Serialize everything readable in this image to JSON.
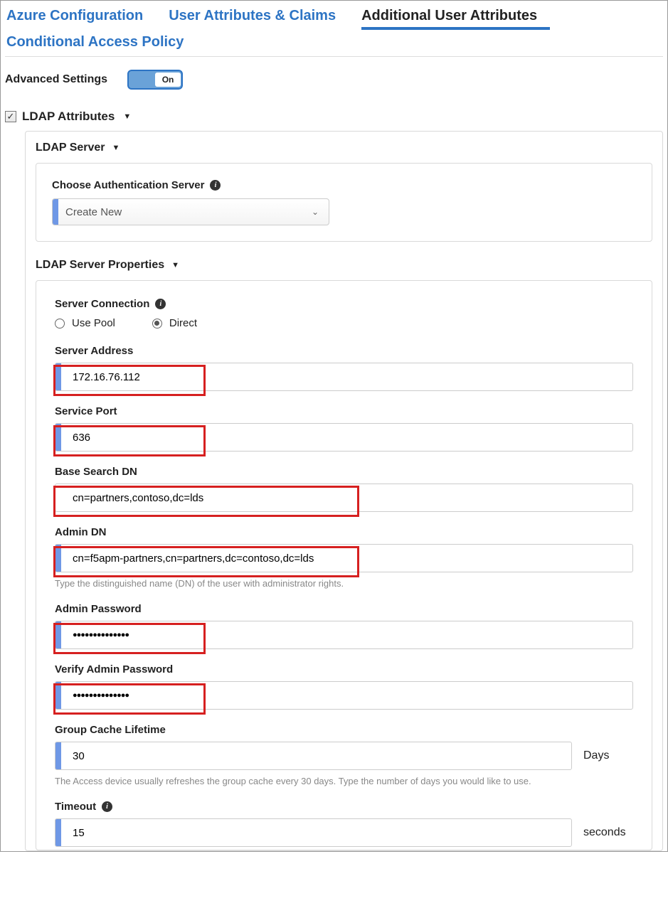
{
  "tabs": {
    "azure": "Azure Configuration",
    "claims": "User Attributes & Claims",
    "additional": "Additional User Attributes",
    "conditional": "Conditional Access Policy"
  },
  "advanced": {
    "label": "Advanced Settings",
    "toggle": "On"
  },
  "sections": {
    "ldap_attributes": "LDAP Attributes",
    "ldap_server": "LDAP Server",
    "ldap_props": "LDAP Server Properties"
  },
  "auth_server": {
    "label": "Choose Authentication Server",
    "value": "Create New"
  },
  "server_connection": {
    "label": "Server Connection",
    "pool": "Use Pool",
    "direct": "Direct"
  },
  "fields": {
    "address_label": "Server Address",
    "address_value": "172.16.76.112",
    "port_label": "Service Port",
    "port_value": "636",
    "basedn_label": "Base Search DN",
    "basedn_value": "cn=partners,contoso,dc=lds",
    "admindn_label": "Admin DN",
    "admindn_value": "cn=f5apm-partners,cn=partners,dc=contoso,dc=lds",
    "admindn_help": "Type the distinguished name (DN) of the user with administrator rights.",
    "adminpw_label": "Admin Password",
    "adminpw_value": "●●●●●●●●●●●●●●",
    "verifypw_label": "Verify Admin Password",
    "verifypw_value": "●●●●●●●●●●●●●●",
    "cache_label": "Group Cache Lifetime",
    "cache_value": "30",
    "cache_suffix": "Days",
    "cache_help": "The Access device usually refreshes the group cache every 30 days. Type the number of days you would like to use.",
    "timeout_label": "Timeout",
    "timeout_value": "15",
    "timeout_suffix": "seconds"
  }
}
